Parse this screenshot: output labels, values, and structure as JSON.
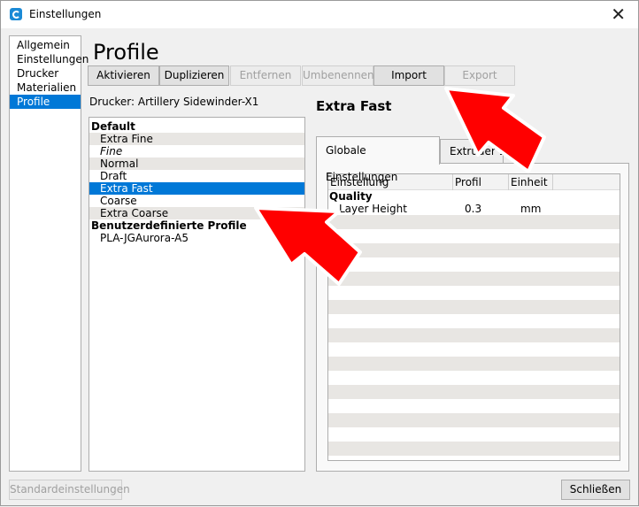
{
  "window": {
    "title": "Einstellungen",
    "close_glyph": "✕",
    "app_icon": "cura-app-icon"
  },
  "nav": {
    "items": [
      {
        "label": "Allgemein",
        "selected": false
      },
      {
        "label": "Einstellungen",
        "selected": false
      },
      {
        "label": "Drucker",
        "selected": false
      },
      {
        "label": "Materialien",
        "selected": false
      },
      {
        "label": "Profile",
        "selected": true
      }
    ]
  },
  "page": {
    "title": "Profile",
    "printer_line": "Drucker: Artillery Sidewinder-X1"
  },
  "toolbar": {
    "activate": "Aktivieren",
    "duplicate": "Duplizieren",
    "remove": "Entfernen",
    "rename": "Umbenennen",
    "import": "Import",
    "export": "Export"
  },
  "profiles": {
    "default_group": "Default",
    "default_items": [
      "Extra Fine",
      "Fine",
      "Normal",
      "Draft",
      "Extra Fast",
      "Coarse",
      "Extra Coarse"
    ],
    "selected": "Extra Fast",
    "custom_group": "Benutzerdefinierte Profile",
    "custom_items": [
      "PLA-JGAurora-A5"
    ]
  },
  "detail": {
    "title": "Extra Fast",
    "tabs": [
      "Globale Einstellungen",
      "Extruder 1"
    ],
    "active_tab": "Globale Einstellungen",
    "columns": [
      "Einstellung",
      "Profil",
      "Einheit"
    ],
    "group": "Quality",
    "rows": [
      {
        "setting": "Layer Height",
        "profile": "0.3",
        "unit": "mm"
      }
    ]
  },
  "footer": {
    "defaults": "Standardeinstellungen",
    "close": "Schließen"
  },
  "colors": {
    "selection": "#0078d7",
    "arrow": "#ff0000",
    "alt_row": "#e8e6e3"
  }
}
